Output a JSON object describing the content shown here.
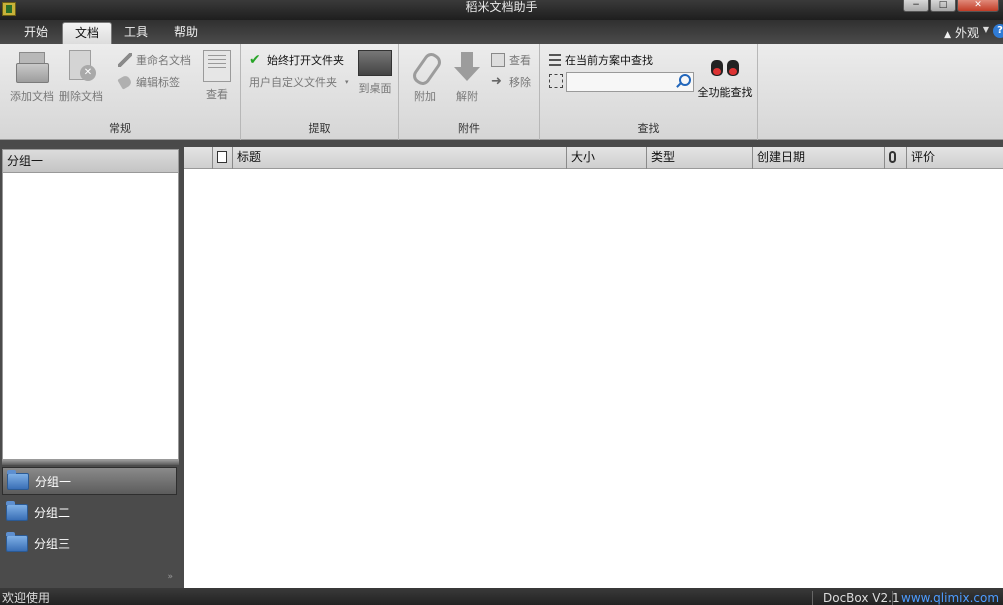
{
  "window": {
    "title": "稻米文档助手",
    "minimize": "−",
    "maximize": "□",
    "close": "✕"
  },
  "tabs": [
    {
      "label": "开始"
    },
    {
      "label": "文档",
      "active": true
    },
    {
      "label": "工具"
    },
    {
      "label": "帮助"
    }
  ],
  "appearance_label": "外观",
  "help_symbol": "?",
  "ribbon": {
    "general": {
      "label": "常规",
      "add_doc": "添加文档",
      "delete_doc": "删除文档",
      "rename_doc": "重命名文档",
      "edit_tags": "编辑标签",
      "view": "查看"
    },
    "extract": {
      "label": "提取",
      "always_open_folder": "始终打开文件夹",
      "custom_folder": "用户自定义文件夹",
      "to_desktop": "到桌面"
    },
    "attachment": {
      "label": "附件",
      "attach": "附加",
      "detach": "解附",
      "view": "查看",
      "remove": "移除"
    },
    "search": {
      "label": "查找",
      "in_current_scheme": "在当前方案中查找",
      "input_value": "",
      "full_search": "全功能查找"
    }
  },
  "left_panel": {
    "header": "分组一",
    "groups": [
      {
        "label": "分组一",
        "selected": true
      },
      {
        "label": "分组二"
      },
      {
        "label": "分组三"
      }
    ],
    "more_symbol": "»"
  },
  "table": {
    "columns": {
      "title": "标题",
      "size": "大小",
      "type": "类型",
      "created": "创建日期",
      "rating": "评价"
    },
    "rows": []
  },
  "status": {
    "text": "欢迎使用",
    "version": "DocBox V2.1",
    "url": "www.qlimix.com"
  }
}
